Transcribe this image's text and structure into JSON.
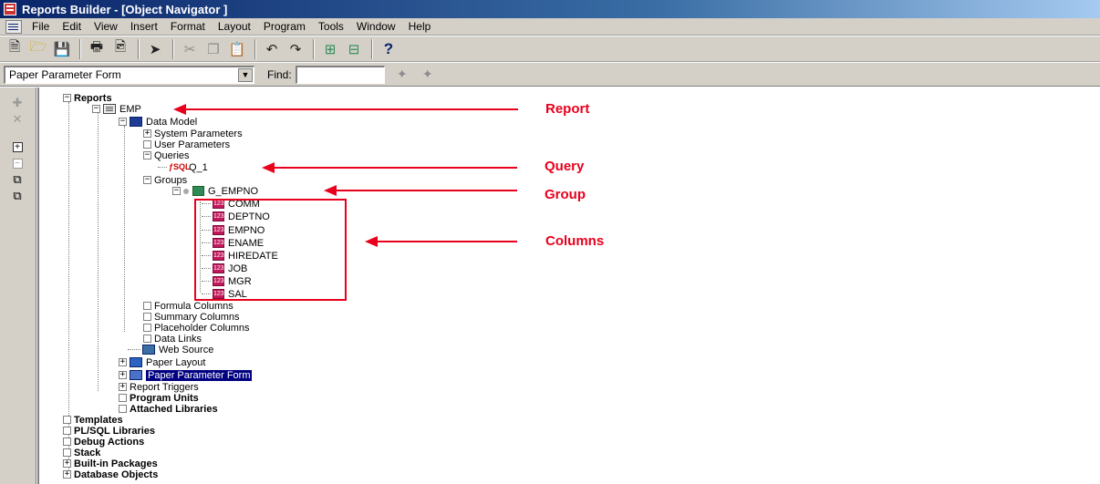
{
  "window": {
    "title": "Reports Builder - [Object Navigator ]"
  },
  "menu": [
    "File",
    "Edit",
    "View",
    "Insert",
    "Format",
    "Layout",
    "Program",
    "Tools",
    "Window",
    "Help"
  ],
  "toolbar": {
    "icons": [
      "new-icon",
      "open-icon",
      "save-icon",
      "print-icon",
      "print-preview-icon",
      "run-icon",
      "cut-icon",
      "copy-icon",
      "paste-icon",
      "undo-icon",
      "redo-icon",
      "expand-all-icon",
      "collapse-all-icon",
      "help-icon"
    ],
    "help_label": "?"
  },
  "findbar": {
    "combo_value": "Paper Parameter Form",
    "find_label": "Find:",
    "find_value": ""
  },
  "tree": {
    "reports": "Reports",
    "emp": "EMP",
    "data_model": "Data Model",
    "system_parameters": "System Parameters",
    "user_parameters": "User Parameters",
    "queries": "Queries",
    "q1": "Q_1",
    "groups": "Groups",
    "g_empno": "G_EMPNO",
    "columns": [
      "COMM",
      "DEPTNO",
      "EMPNO",
      "ENAME",
      "HIREDATE",
      "JOB",
      "MGR",
      "SAL"
    ],
    "formula_columns": "Formula Columns",
    "summary_columns": "Summary Columns",
    "placeholder_columns": "Placeholder Columns",
    "data_links": "Data Links",
    "web_source": "Web Source",
    "paper_layout": "Paper Layout",
    "paper_parameter_form": "Paper Parameter Form",
    "report_triggers": "Report Triggers",
    "program_units": "Program Units",
    "attached_libraries": "Attached Libraries",
    "templates": "Templates",
    "plsql_libraries": "PL/SQL Libraries",
    "debug_actions": "Debug Actions",
    "stack": "Stack",
    "builtin_packages": "Built-in Packages",
    "database_objects": "Database Objects"
  },
  "annotations": {
    "report": "Report",
    "query": "Query",
    "group": "Group",
    "columns": "Columns",
    "color": "#e8001c"
  }
}
